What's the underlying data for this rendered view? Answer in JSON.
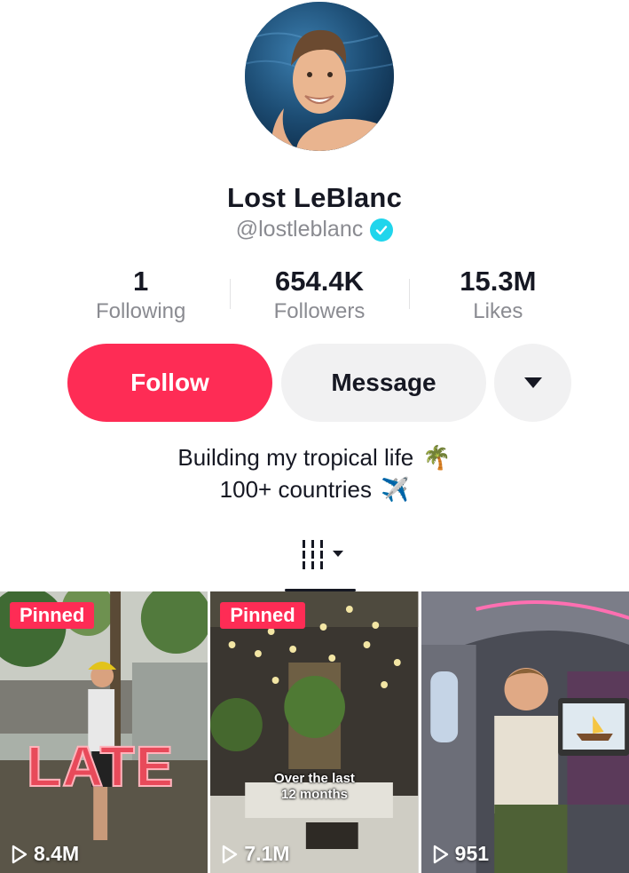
{
  "profile": {
    "display_name": "Lost LeBlanc",
    "handle": "@lostleblanc",
    "verified_icon": "verified-badge-icon"
  },
  "stats": [
    {
      "value": "1",
      "label": "Following"
    },
    {
      "value": "654.4K",
      "label": "Followers"
    },
    {
      "value": "15.3M",
      "label": "Likes"
    }
  ],
  "actions": {
    "follow_label": "Follow",
    "message_label": "Message",
    "more_icon": "caret-down-icon"
  },
  "bio": {
    "line1": "Building my tropical life",
    "line1_emoji": "🌴",
    "line2": "100+ countries",
    "line2_emoji": "✈️"
  },
  "tabs": {
    "active_icon": "grid-videos-icon"
  },
  "videos": [
    {
      "pinned": "Pinned",
      "views": "8.4M",
      "overlay_text": "LATE"
    },
    {
      "pinned": "Pinned",
      "views": "7.1M",
      "caption_line1": "Over the last",
      "caption_line2": "12 months"
    },
    {
      "views": "951"
    }
  ],
  "colors": {
    "accent": "#fe2c55",
    "verified": "#20d5ec",
    "secondary_button": "#f1f1f2"
  }
}
